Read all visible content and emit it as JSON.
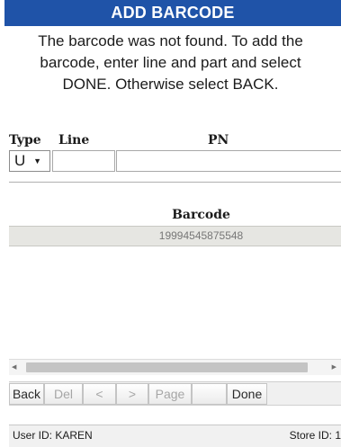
{
  "title": "ADD BARCODE",
  "message": "The barcode was not found. To add the\nbarcode, enter line and part and select\nDONE. Otherwise select BACK.",
  "form": {
    "type_label": "Type",
    "line_label": "Line",
    "pn_label": "PN",
    "type_value": "U",
    "line_value": "",
    "pn_value": ""
  },
  "grid": {
    "header": "Barcode",
    "rows": [
      "19994545875548"
    ]
  },
  "toolbar": {
    "back": "Back",
    "del": "Del",
    "prev": "<",
    "next": ">",
    "page": "Page",
    "blank": "",
    "done": "Done"
  },
  "status": {
    "user": "User ID: KAREN",
    "store": "Store ID: 1"
  },
  "colors": {
    "title_bar": "#1f53a8",
    "row_highlight": "#e6e6e2"
  }
}
